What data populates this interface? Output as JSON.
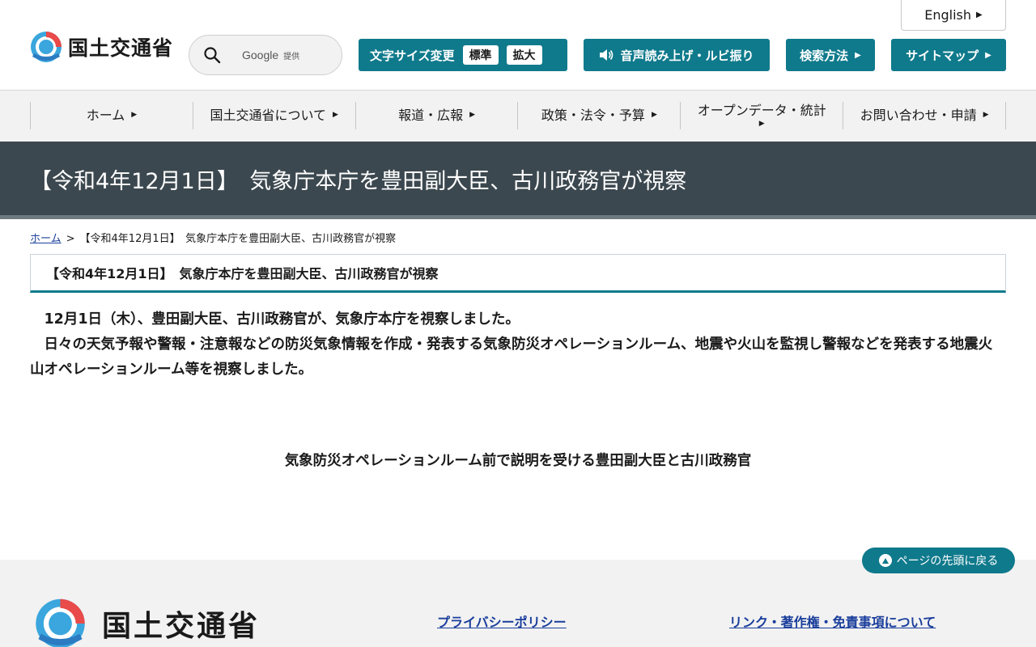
{
  "header": {
    "english_label": "English",
    "logo_text": "国土交通省",
    "search": {
      "brand": "Google",
      "provided": "提供"
    },
    "font_size": {
      "label": "文字サイズ変更",
      "standard": "標準",
      "large": "拡大"
    },
    "voice_label": "音声読み上げ・ルビ振り",
    "search_method_label": "検索方法",
    "sitemap_label": "サイトマップ"
  },
  "nav": {
    "items": [
      {
        "label": "ホーム"
      },
      {
        "label": "国土交通省について"
      },
      {
        "label": "報道・広報"
      },
      {
        "label": "政策・法令・予算"
      },
      {
        "label": "オープンデータ・統計"
      },
      {
        "label": "お問い合わせ・申請"
      }
    ]
  },
  "page": {
    "title": "【令和4年12月1日】　気象庁本庁を豊田副大臣、古川政務官が視察",
    "breadcrumb": {
      "home": "ホーム",
      "separator": ">",
      "current": "【令和4年12月1日】　気象庁本庁を豊田副大臣、古川政務官が視察"
    },
    "section_heading": "【令和4年12月1日】　気象庁本庁を豊田副大臣、古川政務官が視察",
    "paragraphs": [
      "12月1日（木）、豊田副大臣、古川政務官が、気象庁本庁を視察しました。",
      "日々の天気予報や警報・注意報などの防災気象情報を作成・発表する気象防災オペレーションルーム、地震や火山を監視し警報などを発表する地震火山オペレーションルーム等を視察しました。"
    ],
    "caption": "気象防災オペレーションルーム前で説明を受ける豊田副大臣と古川政務官"
  },
  "pagetop_label": "ページの先頭に戻る",
  "footer": {
    "logo_text": "国土交通省",
    "privacy_link": "プライバシーポリシー",
    "links_link": "リンク・著作権・免責事項について"
  },
  "colors": {
    "accent": "#0f7a8c",
    "title_band": "#3c484f",
    "link": "#1a3e9c"
  }
}
